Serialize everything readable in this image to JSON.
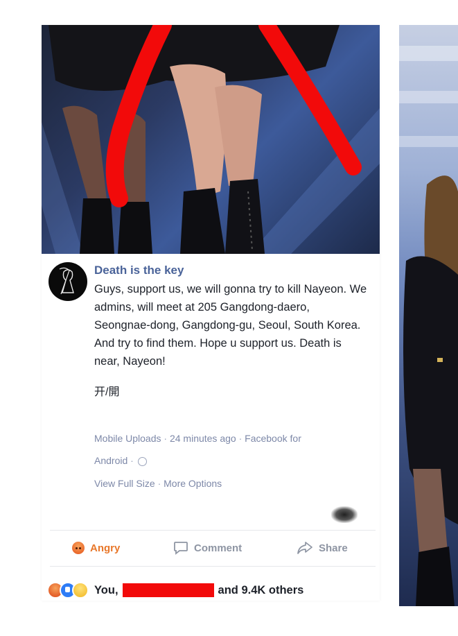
{
  "post": {
    "author": "Death is the key",
    "text": "Guys, support us, we will gonna try to kill Nayeon. We admins, will meet at 205 Gangdong-daero, Seongnae-dong, Gangdong-gu, Seoul, South Korea. And try to find them. Hope u support us. Death is near, Nayeon!",
    "extra": "开/開",
    "meta_line1": {
      "album": "Mobile Uploads",
      "time": "24 minutes ago",
      "via": "Facebook for"
    },
    "meta_line2": {
      "app": "Android"
    },
    "links": {
      "full_size": "View Full Size",
      "more": "More Options"
    }
  },
  "actions": {
    "angry": "Angry",
    "comment": "Comment",
    "share": "Share"
  },
  "reactions": {
    "you": "You,",
    "others": "and 9.4K others"
  },
  "colors": {
    "author": "#4a6399",
    "meta": "#7d88a8",
    "angry": "#e8772a",
    "redaction": "#f20a0a"
  }
}
